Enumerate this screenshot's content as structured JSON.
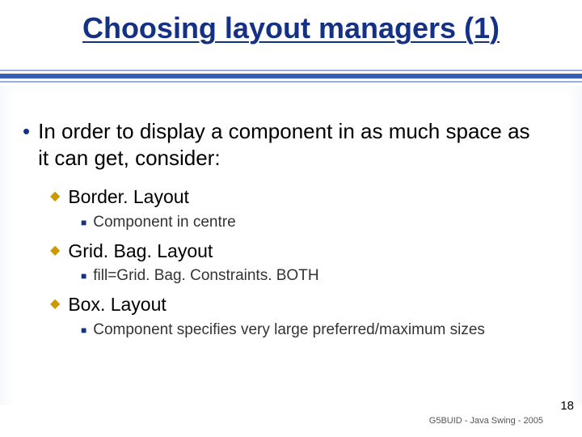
{
  "title": "Choosing layout managers (1)",
  "intro": "In order to display a component in as much space as it can get, consider:",
  "items": [
    {
      "name": "Border. Layout",
      "detail": "Component in centre"
    },
    {
      "name": "Grid. Bag. Layout",
      "detail": "fill=Grid. Bag. Constraints. BOTH"
    },
    {
      "name": "Box. Layout",
      "detail": "Component specifies very large preferred/maximum sizes"
    }
  ],
  "footer": "G5BUID - Java Swing - 2005",
  "page": "18"
}
